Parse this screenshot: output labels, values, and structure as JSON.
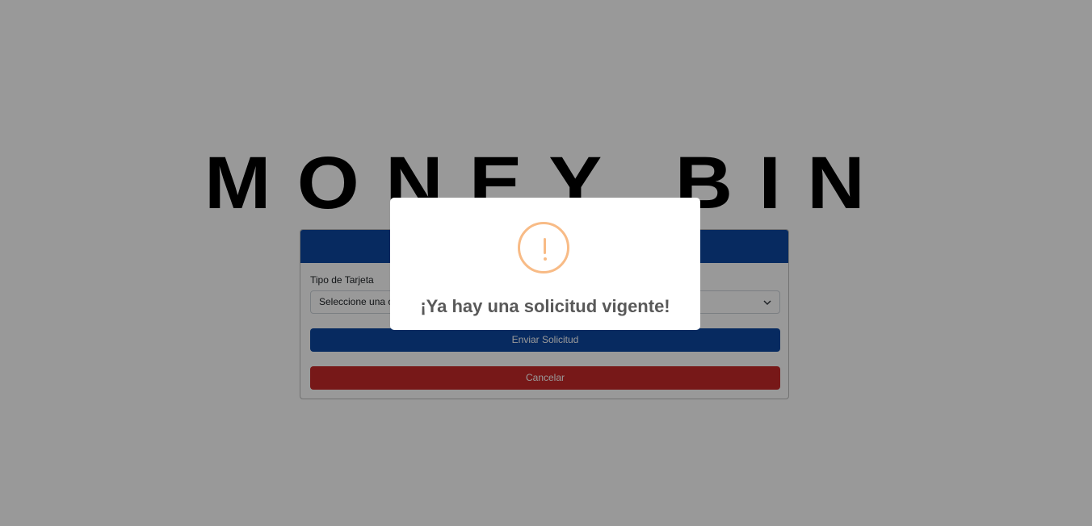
{
  "brand": {
    "logo_text": "MONEY BIN"
  },
  "form": {
    "card_label": "Tipo de Tarjeta",
    "select_value": "Seleccione una o",
    "submit_label": "Enviar Solicitud",
    "cancel_label": "Cancelar"
  },
  "alert": {
    "icon": "warning-icon",
    "title": "¡Ya hay una solicitud vigente!"
  },
  "colors": {
    "primary": "#0d47a1",
    "danger": "#c62828",
    "warning": "#f8bb86",
    "overlay": "rgba(0,0,0,0.4)"
  }
}
